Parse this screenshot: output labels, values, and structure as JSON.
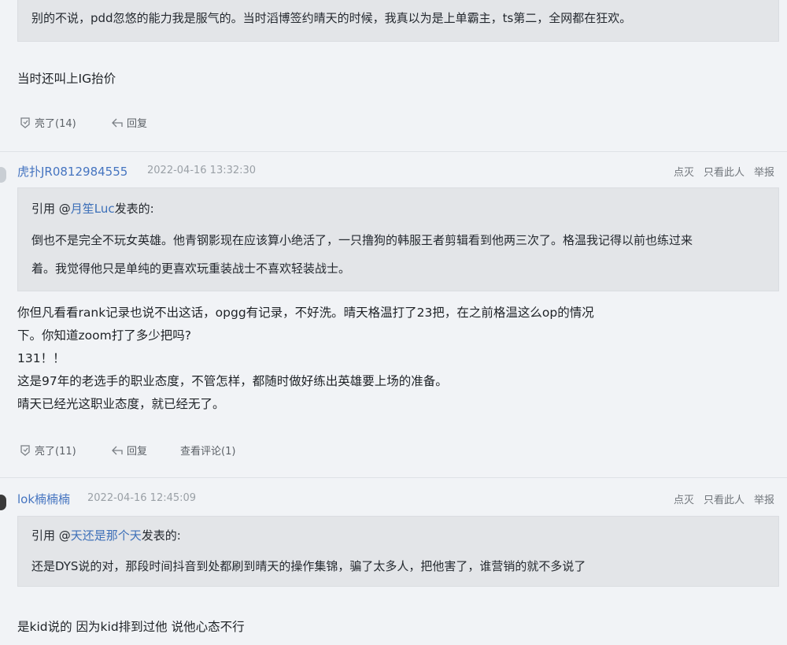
{
  "post0": {
    "quote_line": "别的不说，pdd忽悠的能力我是服气的。当时滔博签约晴天的时候，我真以为是上单霸主，ts第二，全网都在狂欢。",
    "reply": "当时还叫上IG抬价",
    "like_label": "亮了(14)",
    "reply_label": "回复"
  },
  "post1": {
    "username": "虎扑JR0812984555",
    "timestamp": "2022-04-16 13:32:30",
    "tools": [
      "点灭",
      "只看此人",
      "举报"
    ],
    "quote_prefix": "引用 @",
    "quote_user": "月笙Luc",
    "quote_suffix": "发表的:",
    "quote_lines": [
      "倒也不是完全不玩女英雄。他青钢影现在应该算小绝活了，一只撸狗的韩服王者剪辑看到他两三次了。格温我记得以前也练过来",
      "着。我觉得他只是单纯的更喜欢玩重装战士不喜欢轻装战士。"
    ],
    "body_lines": [
      "你但凡看看rank记录也说不出这话，opgg有记录，不好洗。晴天格温打了23把，在之前格温这么op的情况",
      "下。你知道zoom打了多少把吗?",
      "131！！",
      "这是97年的老选手的职业态度，不管怎样，都随时做好练出英雄要上场的准备。",
      "晴天已经光这职业态度，就已经无了。"
    ],
    "like_label": "亮了(11)",
    "reply_label": "回复",
    "view_comments_label": "查看评论(1)"
  },
  "post2": {
    "username": "lok楠楠楠",
    "timestamp": "2022-04-16 12:45:09",
    "tools": [
      "点灭",
      "只看此人",
      "举报"
    ],
    "quote_prefix": "引用 @",
    "quote_user": "天还是那个天",
    "quote_suffix": "发表的:",
    "quote_lines": [
      "还是DYS说的对，那段时间抖音到处都刷到晴天的操作集锦，骗了太多人，把他害了，谁营销的就不多说了"
    ],
    "body_lines": [
      "是kid说的 因为kid排到过他 说他心态不行"
    ]
  }
}
